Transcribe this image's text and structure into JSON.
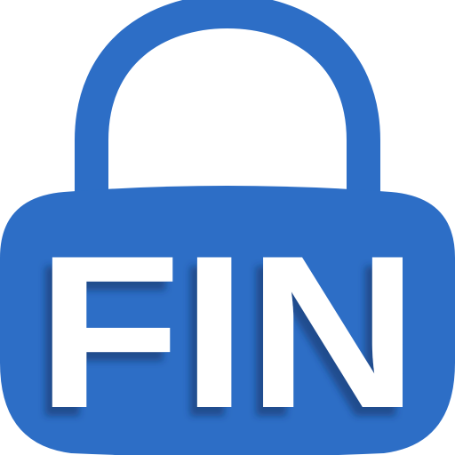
{
  "icon": {
    "name": "padlock-fin-icon",
    "text": "FIN"
  },
  "colors": {
    "lock_blue": "#2d6ec6",
    "text_white": "#ffffff",
    "shadow": "#12325f"
  }
}
